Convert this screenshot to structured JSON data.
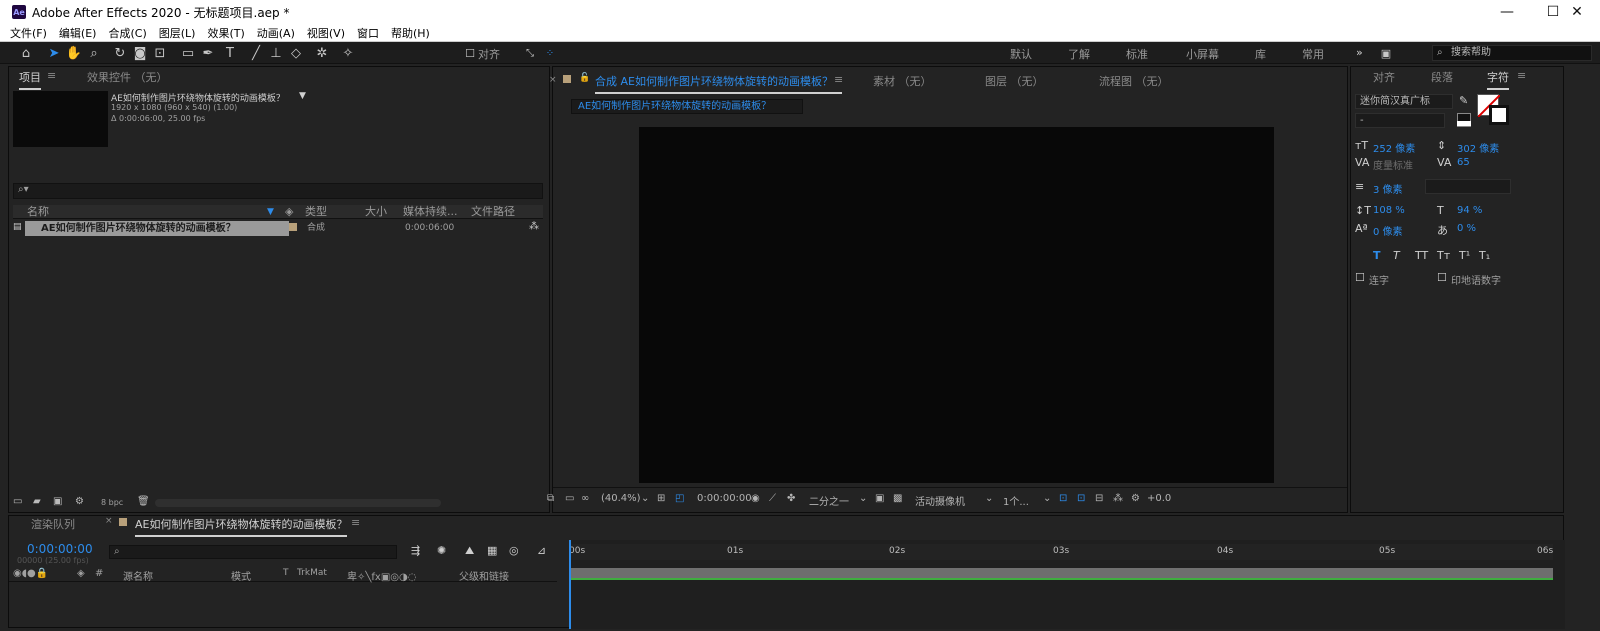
{
  "title_bar": {
    "app_badge": "Ae",
    "title": "Adobe After Effects 2020 - 无标题项目.aep *",
    "minimize": "—",
    "maximize": "☐",
    "close": "✕"
  },
  "menu": [
    "文件(F)",
    "编辑(E)",
    "合成(C)",
    "图层(L)",
    "效果(T)",
    "动画(A)",
    "视图(V)",
    "窗口",
    "帮助(H)"
  ],
  "toolbar": {
    "snap_label": "对齐",
    "workspaces": [
      "默认",
      "了解",
      "标准",
      "小屏幕",
      "库",
      "常用"
    ],
    "active_workspace": "常用",
    "more": "»",
    "search_placeholder": "搜索帮助"
  },
  "project_panel": {
    "tab_project": "项目",
    "tab_effects": "效果控件 （无）",
    "comp_name": "AE如何制作图片环绕物体旋转的动画模板？",
    "comp_size": "1920 x 1080  (960 x 540) (1.00)",
    "comp_duration": "Δ 0:00:06:00, 25.00 fps",
    "columns": [
      "名称",
      "类型",
      "大小",
      "媒体持续...",
      "文件路径"
    ],
    "row": {
      "name": "AE如何制作图片环绕物体旋转的动画模板？",
      "type": "合成",
      "duration": "0:00:06:00"
    },
    "bpc": "8 bpc"
  },
  "viewer": {
    "comp_tab": "合成 AE如何制作图片环绕物体旋转的动画模板？",
    "tab_footage": "素材 （无）",
    "tab_layer": "图层 （无）",
    "tab_flowchart": "流程图 （无）",
    "flow_button": "AE如何制作图片环绕物体旋转的动画模板？",
    "zoom": "(40.4%)",
    "timecode": "0:00:00:00",
    "resolution": "二分之一",
    "camera": "活动摄像机",
    "views": "1个...",
    "exposure": "+0.0"
  },
  "character_panel": {
    "tab_align": "对齐",
    "tab_paragraph": "段落",
    "tab_character": "字符",
    "font": "迷你简汉真广标",
    "font_style": "-",
    "font_size": "252 像素",
    "leading": "302 像素",
    "kerning": "度量标准",
    "tracking": "65",
    "stroke_width": "3 像素",
    "vert_scale": "108 %",
    "horiz_scale": "94 %",
    "baseline_shift": "0 像素",
    "tsume": "0 %",
    "ligatures": "连字",
    "hindi_digits": "印地语数字",
    "style_buttons": [
      "T",
      "T",
      "TT",
      "Tт",
      "T¹",
      "T₁"
    ]
  },
  "timeline": {
    "tab_render": "渲染队列",
    "tab_comp": "AE如何制作图片环绕物体旋转的动画模板？",
    "timecode": "0:00:00:00",
    "sub_timecode": "00000 (25.00 fps)",
    "col_source": "源名称",
    "col_mode": "模式",
    "col_t": "T",
    "col_trkmat": "TrkMat",
    "col_parent": "父级和链接",
    "ticks": [
      "00s",
      "01s",
      "02s",
      "03s",
      "04s",
      "05s",
      "06s"
    ]
  },
  "colors": {
    "accent": "#2d8ceb",
    "panel": "#232323",
    "canvas": "#080808",
    "work_area": "#3fae3f"
  }
}
